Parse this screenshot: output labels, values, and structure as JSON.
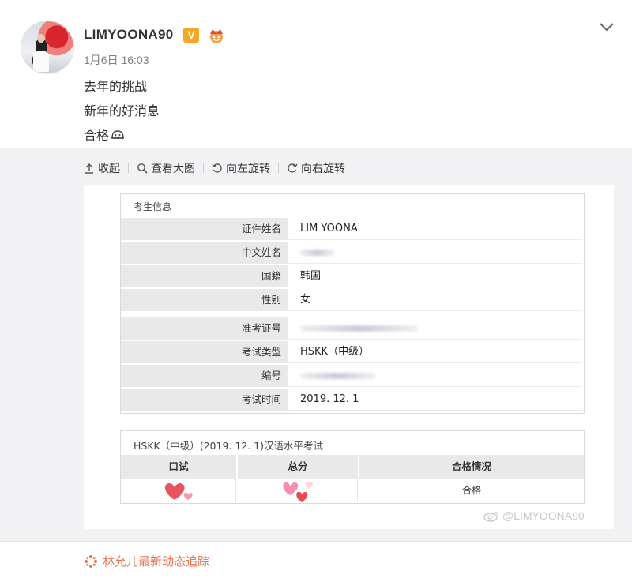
{
  "post": {
    "username": "LIMYOONA90",
    "vip_badge": "V",
    "time": "1月6日 16:03",
    "lines": [
      "去年的挑战",
      "新年的好消息",
      "合格"
    ]
  },
  "toolbar": {
    "collapse": "收起",
    "view_large": "查看大图",
    "rotate_left": "向左旋转",
    "rotate_right": "向右旋转"
  },
  "certificate": {
    "section_title": "考生信息",
    "rows": [
      {
        "label": "证件姓名",
        "value": "LIM YOONA"
      },
      {
        "label": "中文姓名",
        "value": ""
      },
      {
        "label": "国籍",
        "value": "韩国"
      },
      {
        "label": "性别",
        "value": "女"
      },
      {
        "label": "准考证号",
        "value": ""
      },
      {
        "label": "考试类型",
        "value": "HSKK（中级）"
      },
      {
        "label": "编号",
        "value": ""
      },
      {
        "label": "考试时间",
        "value": "2019. 12. 1"
      }
    ],
    "score_title": "HSKK（中级）(2019. 12. 1)汉语水平考试",
    "score_headers": [
      "口试",
      "总分",
      "合格情况"
    ],
    "result": "合格"
  },
  "watermark": "@LIMYOONA90",
  "topic_link": "林允儿最新动态追踪",
  "colors": {
    "accent": "#eb7350",
    "badge": "#f5a623",
    "panel_bg": "#f2f2f5"
  }
}
